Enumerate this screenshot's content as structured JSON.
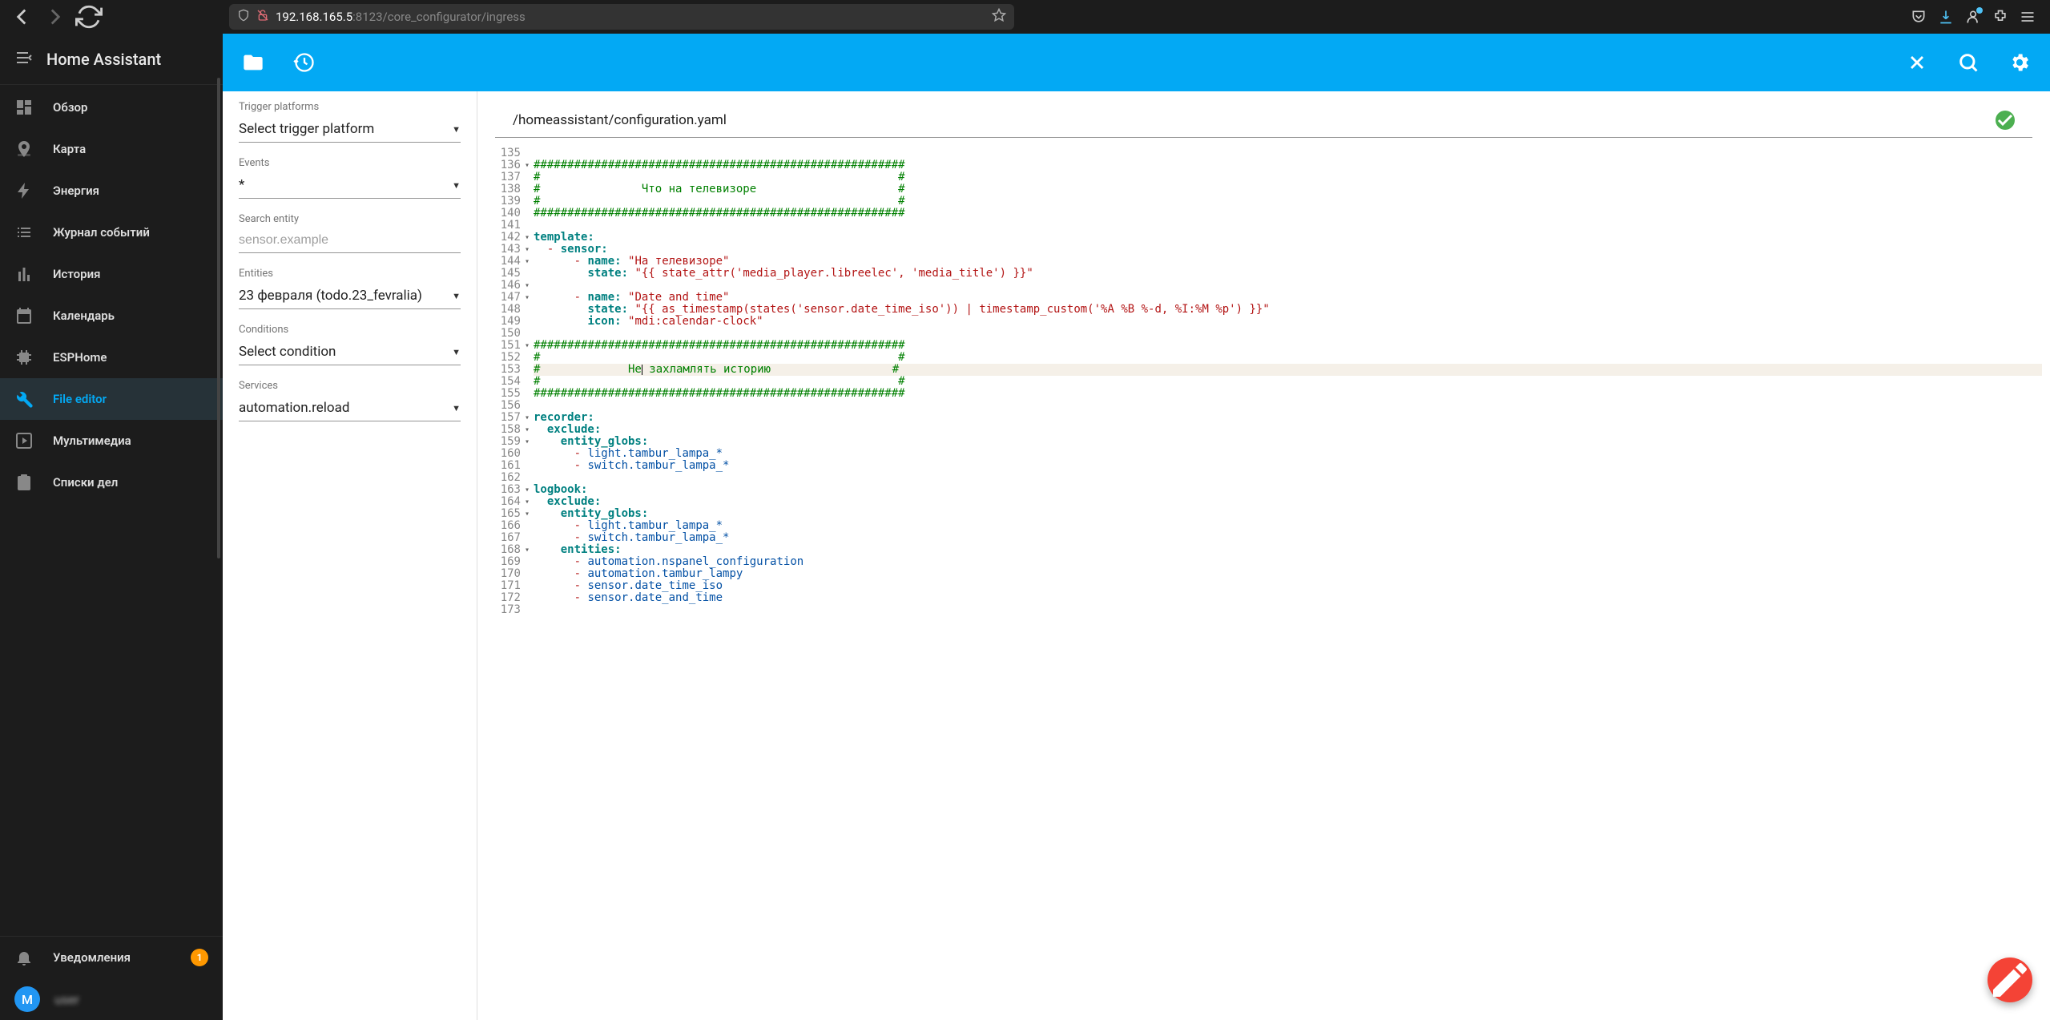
{
  "browser": {
    "url_host": "192.168.165.5",
    "url_port": ":8123",
    "url_path": "/core_configurator/ingress"
  },
  "app_title": "Home Assistant",
  "sidebar": {
    "items": [
      {
        "label": "Обзор",
        "icon": "dashboard"
      },
      {
        "label": "Карта",
        "icon": "map"
      },
      {
        "label": "Энергия",
        "icon": "bolt"
      },
      {
        "label": "Журнал событий",
        "icon": "list"
      },
      {
        "label": "История",
        "icon": "chart"
      },
      {
        "label": "Календарь",
        "icon": "calendar"
      },
      {
        "label": "ESPHome",
        "icon": "chip"
      },
      {
        "label": "File editor",
        "icon": "wrench",
        "active": true
      },
      {
        "label": "Мультимедиа",
        "icon": "play"
      },
      {
        "label": "Списки дел",
        "icon": "clipboard"
      }
    ],
    "notifications_label": "Уведомления",
    "notifications_count": "1",
    "user_initial": "M"
  },
  "left_panel": {
    "trigger_label": "Trigger platforms",
    "trigger_value": "Select trigger platform",
    "events_label": "Events",
    "events_value": "*",
    "search_label": "Search entity",
    "search_placeholder": "sensor.example",
    "entities_label": "Entities",
    "entities_value": "23 февраля (todo.23_fevralia)",
    "conditions_label": "Conditions",
    "conditions_value": "Select condition",
    "services_label": "Services",
    "services_value": "automation.reload"
  },
  "editor": {
    "file_path": "/homeassistant/configuration.yaml",
    "lines": [
      {
        "num": 135,
        "fold": false,
        "html": ""
      },
      {
        "num": 136,
        "fold": true,
        "html": "<span class='tok-comment'>#######################################################</span>"
      },
      {
        "num": 137,
        "fold": false,
        "html": "<span class='tok-comment'>#                                                     #</span>"
      },
      {
        "num": 138,
        "fold": false,
        "html": "<span class='tok-comment'>#               Что на телевизоре                     #</span>"
      },
      {
        "num": 139,
        "fold": false,
        "html": "<span class='tok-comment'>#                                                     #</span>"
      },
      {
        "num": 140,
        "fold": false,
        "html": "<span class='tok-comment'>#######################################################</span>"
      },
      {
        "num": 141,
        "fold": false,
        "html": ""
      },
      {
        "num": 142,
        "fold": true,
        "html": "<span class='tok-key'>template:</span>"
      },
      {
        "num": 143,
        "fold": true,
        "html": "  <span class='tok-dash'>-</span> <span class='tok-key'>sensor:</span>"
      },
      {
        "num": 144,
        "fold": true,
        "html": "      <span class='tok-dash'>-</span> <span class='tok-key'>name:</span> <span class='tok-str'>\"На телевизоре\"</span>"
      },
      {
        "num": 145,
        "fold": false,
        "html": "        <span class='tok-key'>state:</span> <span class='tok-str'>\"{{ state_attr('media_player.libreelec', 'media_title') }}\"</span>"
      },
      {
        "num": 146,
        "fold": true,
        "html": ""
      },
      {
        "num": 147,
        "fold": true,
        "html": "      <span class='tok-dash'>-</span> <span class='tok-key'>name:</span> <span class='tok-str'>\"Date and time\"</span>"
      },
      {
        "num": 148,
        "fold": false,
        "html": "        <span class='tok-key'>state:</span> <span class='tok-str'>\"{{ as_timestamp(states('sensor.date_time_iso')) | timestamp_custom('%A %B %-d, %I:%M %p') }}\"</span>"
      },
      {
        "num": 149,
        "fold": false,
        "html": "        <span class='tok-key'>icon:</span> <span class='tok-str'>\"mdi:calendar-clock\"</span>"
      },
      {
        "num": 150,
        "fold": false,
        "html": ""
      },
      {
        "num": 151,
        "fold": true,
        "html": "<span class='tok-comment'>#######################################################</span>"
      },
      {
        "num": 152,
        "fold": false,
        "html": "<span class='tok-comment'>#                                                     #</span>"
      },
      {
        "num": 153,
        "fold": false,
        "hl": true,
        "html": "<span class='tok-comment'>#             Не<span class='cursor-mark'></span> захламлять историю                  #</span>"
      },
      {
        "num": 154,
        "fold": false,
        "html": "<span class='tok-comment'>#                                                     #</span>"
      },
      {
        "num": 155,
        "fold": false,
        "html": "<span class='tok-comment'>#######################################################</span>"
      },
      {
        "num": 156,
        "fold": false,
        "html": ""
      },
      {
        "num": 157,
        "fold": true,
        "html": "<span class='tok-key'>recorder:</span>"
      },
      {
        "num": 158,
        "fold": true,
        "html": "  <span class='tok-key'>exclude:</span>"
      },
      {
        "num": 159,
        "fold": true,
        "html": "    <span class='tok-key'>entity_globs:</span>"
      },
      {
        "num": 160,
        "fold": false,
        "html": "      <span class='tok-dash'>-</span> <span class='tok-plain'>light.tambur_lampa_*</span>"
      },
      {
        "num": 161,
        "fold": false,
        "html": "      <span class='tok-dash'>-</span> <span class='tok-plain'>switch.tambur_lampa_*</span>"
      },
      {
        "num": 162,
        "fold": false,
        "html": ""
      },
      {
        "num": 163,
        "fold": true,
        "html": "<span class='tok-key'>logbook:</span>"
      },
      {
        "num": 164,
        "fold": true,
        "html": "  <span class='tok-key'>exclude:</span>"
      },
      {
        "num": 165,
        "fold": true,
        "html": "    <span class='tok-key'>entity_globs:</span>"
      },
      {
        "num": 166,
        "fold": false,
        "html": "      <span class='tok-dash'>-</span> <span class='tok-plain'>light.tambur_lampa_*</span>"
      },
      {
        "num": 167,
        "fold": false,
        "html": "      <span class='tok-dash'>-</span> <span class='tok-plain'>switch.tambur_lampa_*</span>"
      },
      {
        "num": 168,
        "fold": true,
        "html": "    <span class='tok-key'>entities:</span>"
      },
      {
        "num": 169,
        "fold": false,
        "html": "      <span class='tok-dash'>-</span> <span class='tok-plain'>automation.nspanel_configuration</span>"
      },
      {
        "num": 170,
        "fold": false,
        "html": "      <span class='tok-dash'>-</span> <span class='tok-plain'>automation.tambur_lampy</span>"
      },
      {
        "num": 171,
        "fold": false,
        "html": "      <span class='tok-dash'>-</span> <span class='tok-plain'>sensor.date_time_iso</span>"
      },
      {
        "num": 172,
        "fold": false,
        "html": "      <span class='tok-dash'>-</span> <span class='tok-plain'>sensor.date_and_time</span>"
      },
      {
        "num": 173,
        "fold": false,
        "html": ""
      }
    ]
  }
}
